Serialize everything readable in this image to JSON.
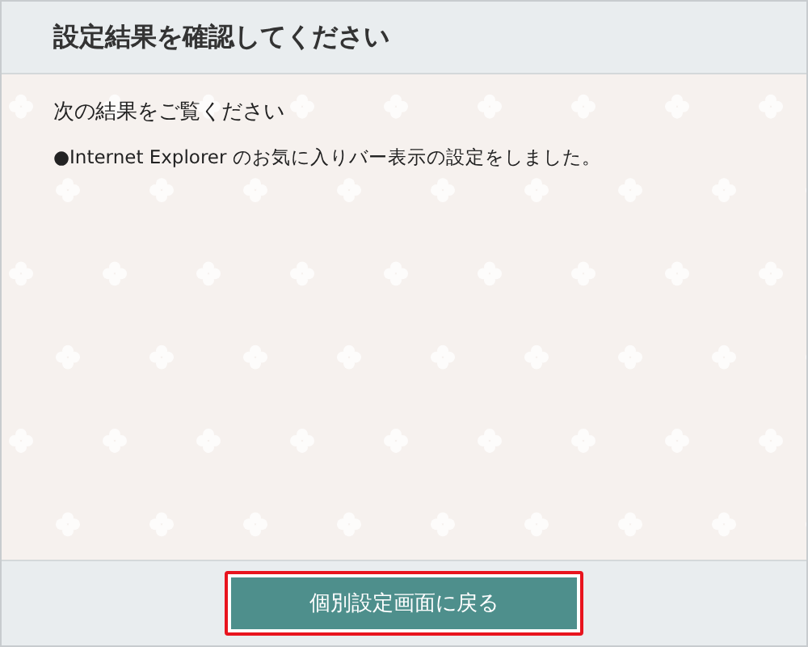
{
  "header": {
    "title": "設定結果を確認してください"
  },
  "content": {
    "heading": "次の結果をご覧ください",
    "results": [
      "●Internet Explorer のお気に入りバー表示の設定をしました。"
    ]
  },
  "footer": {
    "button": {
      "label": "個別設定画面に戻る",
      "highlighted": true
    }
  }
}
